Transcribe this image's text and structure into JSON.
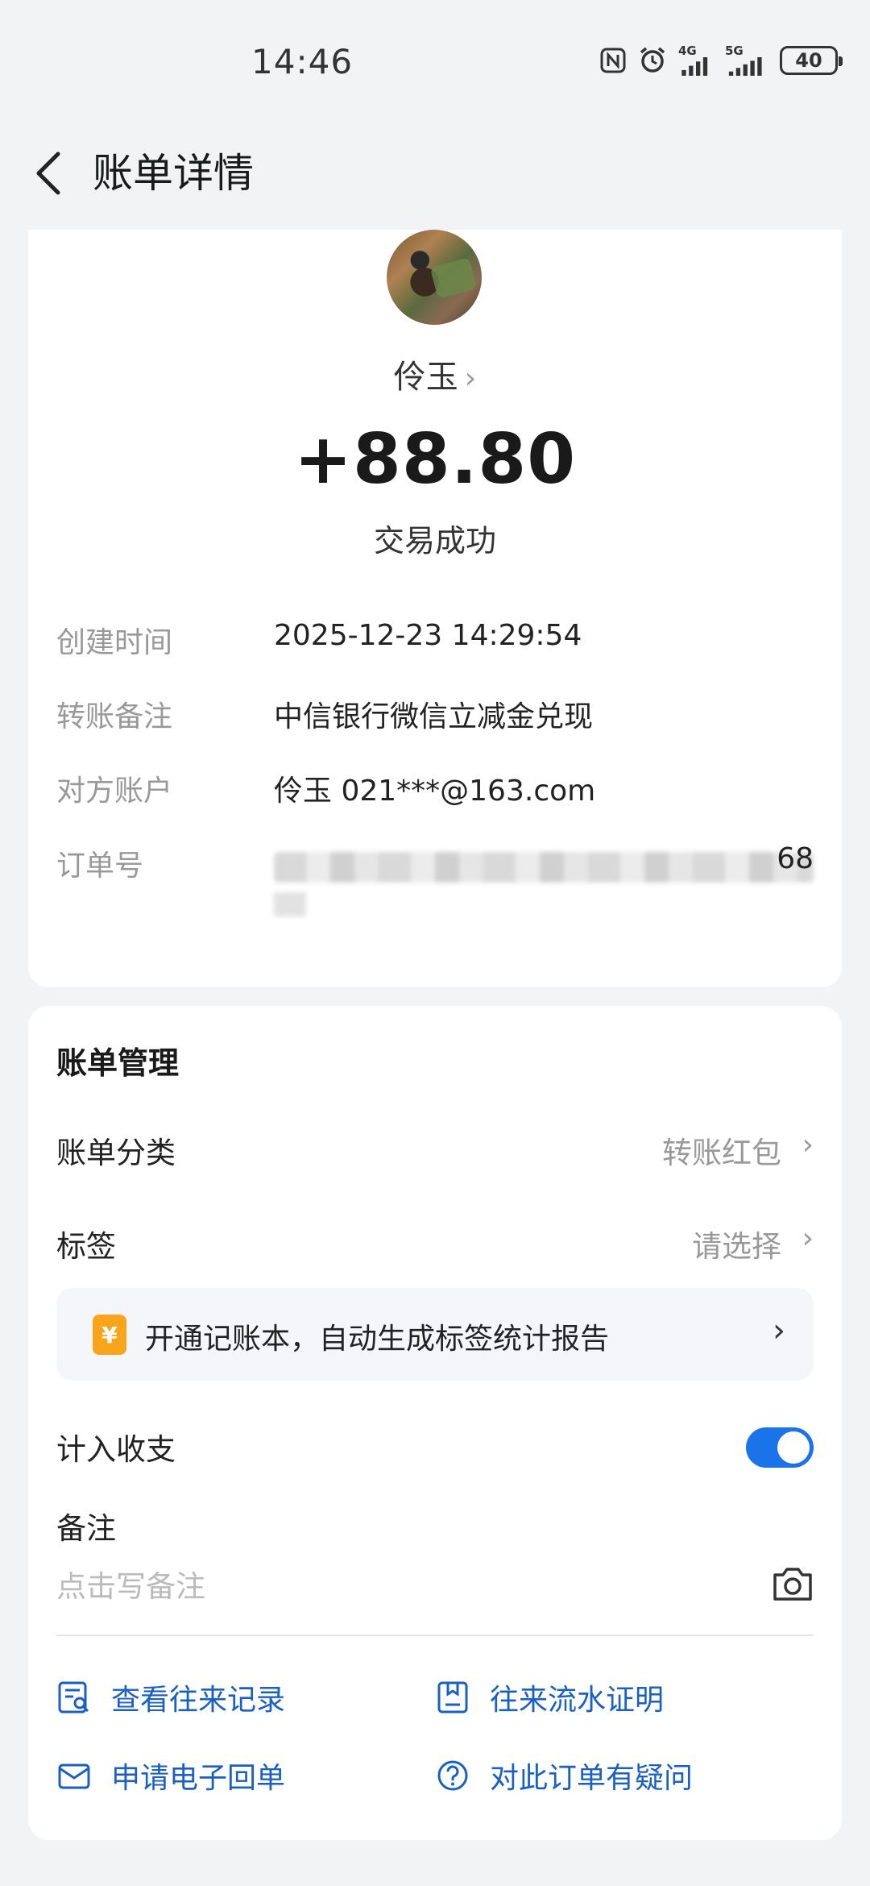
{
  "status_bar": {
    "time": "14:46",
    "net1": "4G",
    "net2": "5G",
    "battery": "40"
  },
  "header": {
    "title": "账单详情"
  },
  "transaction": {
    "payee_name": "伶玉",
    "amount": "+88.80",
    "status": "交易成功",
    "details": [
      {
        "label": "创建时间",
        "value": "2025-12-23 14:29:54"
      },
      {
        "label": "转账备注",
        "value": "中信银行微信立减金兑现"
      },
      {
        "label": "对方账户",
        "value": "伶玉 021***@163.com"
      },
      {
        "label": "订单号",
        "value": ""
      }
    ],
    "order_tail": "68"
  },
  "manage": {
    "title": "账单管理",
    "category_label": "账单分类",
    "category_value": "转账红包",
    "tag_label": "标签",
    "tag_value": "请选择",
    "promo_icon": "¥",
    "promo_text": "开通记账本，自动生成标签统计报告",
    "income_label": "计入收支",
    "income_toggle_on": true,
    "note_label": "备注",
    "note_placeholder": "点击写备注",
    "actions": [
      {
        "label": "查看往来记录",
        "icon": "record-search-icon"
      },
      {
        "label": "往来流水证明",
        "icon": "document-icon"
      },
      {
        "label": "申请电子回单",
        "icon": "mail-icon"
      },
      {
        "label": "对此订单有疑问",
        "icon": "question-icon"
      }
    ]
  },
  "colors": {
    "accent": "#1a73e8",
    "link": "#1a5fc4",
    "promo_icon": "#f8a51c"
  }
}
